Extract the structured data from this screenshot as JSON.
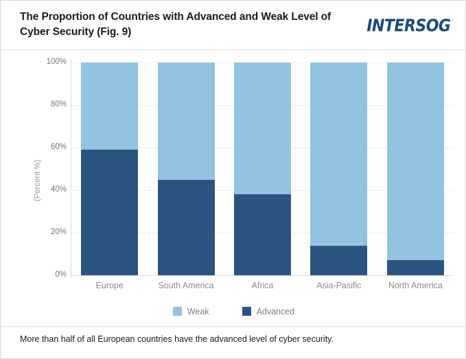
{
  "header": {
    "title": "The Proportion of Countries with Advanced and Weak Level of Cyber Security (Fig. 9)",
    "logo_text": "INTERSOG",
    "logo_tm": "´",
    "logo_color": "#1b4a7a"
  },
  "caption": {
    "text": "More than half of all European countries have the advanced level of cyber security."
  },
  "legend": {
    "items": [
      {
        "label": "Weak",
        "color": "#92c3e0"
      },
      {
        "label": "Advanced",
        "color": "#2b5580"
      }
    ]
  },
  "axis": {
    "y_title": "(Percent %)",
    "y_ticks": [
      "0%",
      "20%",
      "40%",
      "60%",
      "80%",
      "100%"
    ]
  },
  "chart_data": {
    "type": "bar",
    "subtype": "stacked-percentage",
    "title": "The Proportion of Countries with Advanced and Weak Level of Cyber Security (Fig. 9)",
    "xlabel": "",
    "ylabel": "(Percent %)",
    "ylim": [
      0,
      100
    ],
    "ytick_values": [
      0,
      20,
      40,
      60,
      80,
      100
    ],
    "ytick_labels": [
      "0%",
      "20%",
      "40%",
      "60%",
      "80%",
      "100%"
    ],
    "grid": true,
    "legend_position": "bottom-center",
    "categories": [
      "Europe",
      "South America",
      "Africa",
      "Asia-Pasific",
      "North America"
    ],
    "series": [
      {
        "name": "Weak",
        "color": "#92c3e0",
        "values": [
          41,
          55,
          62,
          86,
          93
        ]
      },
      {
        "name": "Advanced",
        "color": "#2b5580",
        "values": [
          59,
          45,
          38,
          14,
          7
        ]
      }
    ]
  }
}
